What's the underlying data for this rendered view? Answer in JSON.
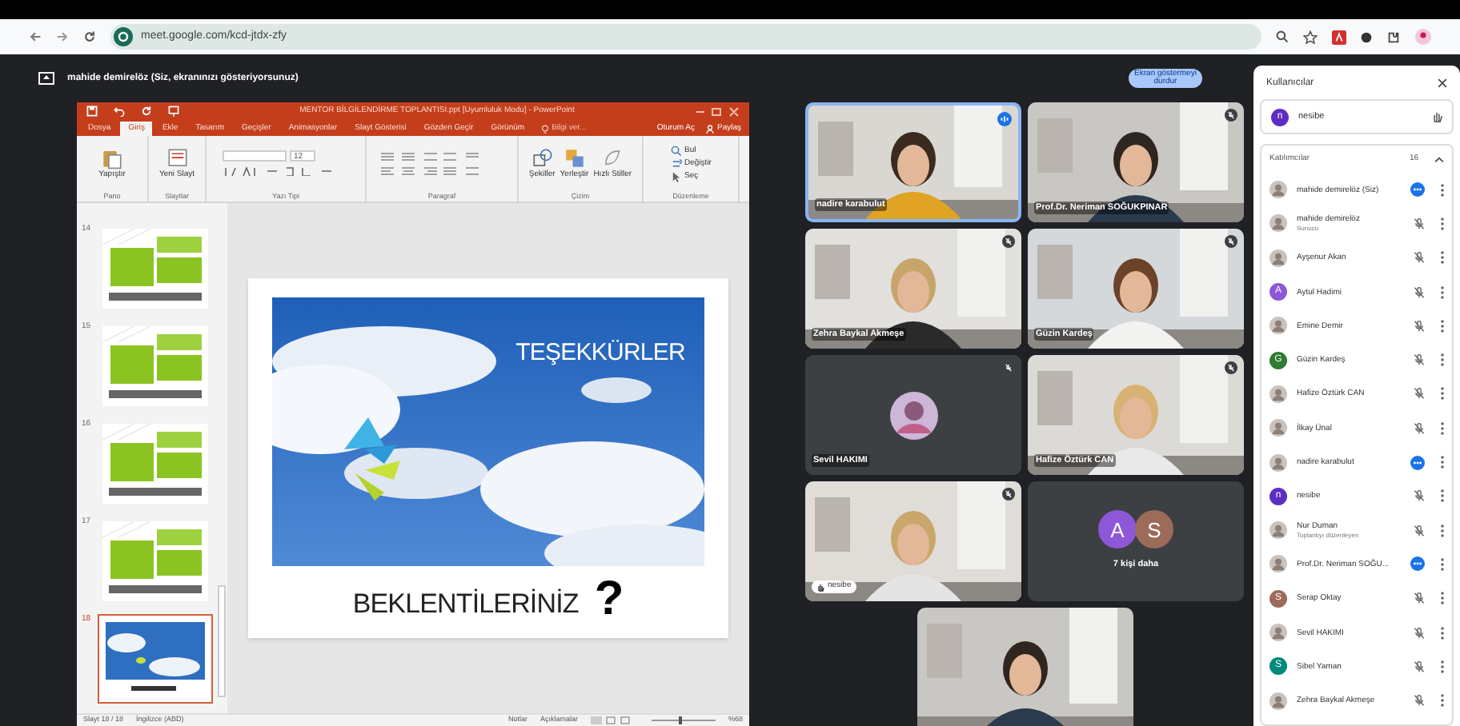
{
  "browser": {
    "url": "meet.google.com/kcd-jtdx-zfy"
  },
  "presenting_bar": {
    "text": "mahide demirelöz (Siz, ekranınızı gösteriyorsunuz)",
    "stop_button": "Ekran göstermeyi durdur"
  },
  "powerpoint": {
    "title": "MENTOR BİLGİLENDİRME TOPLANTISI.ppt [Uyumluluk Modu] - PowerPoint",
    "tabs": [
      {
        "label": "Dosya",
        "selected": false
      },
      {
        "label": "Giriş",
        "selected": true
      },
      {
        "label": "Ekle",
        "selected": false
      },
      {
        "label": "Tasarım",
        "selected": false
      },
      {
        "label": "Geçişler",
        "selected": false
      },
      {
        "label": "Animasyonlar",
        "selected": false
      },
      {
        "label": "Slayt Gösterisi",
        "selected": false
      },
      {
        "label": "Gözden Geçir",
        "selected": false
      },
      {
        "label": "Görünüm",
        "selected": false
      }
    ],
    "tell_me": "Bilgi ver...",
    "sign_in": "Oturum Aç",
    "share": "Paylaş",
    "ribbon": [
      {
        "kind": "buttons",
        "label": "Pano",
        "buttons": [
          {
            "kind": "paste",
            "label": "Yapıştır"
          }
        ]
      },
      {
        "kind": "buttons",
        "label": "Slaytlar",
        "buttons": [
          {
            "kind": "new_slide",
            "label": "Yeni Slayt"
          }
        ]
      },
      {
        "kind": "font",
        "label": "Yazı Tipi",
        "font_size": "12"
      },
      {
        "kind": "paragraph",
        "label": "Paragraf"
      },
      {
        "kind": "buttons",
        "label": "Çizim",
        "buttons": [
          {
            "kind": "shapes",
            "label": "Şekiller"
          },
          {
            "kind": "arrange",
            "label": "Yerleştir"
          },
          {
            "kind": "styles",
            "label": "Hızlı Stiller"
          }
        ]
      },
      {
        "kind": "editing",
        "label": "Düzenleme",
        "buttons": [
          {
            "kind": "find",
            "label": "Bul"
          },
          {
            "kind": "replace",
            "label": "Değiştir"
          },
          {
            "kind": "select",
            "label": "Seç"
          }
        ]
      }
    ],
    "thumbnails": [
      {
        "number": "14",
        "kind": "table",
        "selected": false
      },
      {
        "number": "15",
        "kind": "table",
        "selected": false
      },
      {
        "number": "16",
        "kind": "table",
        "selected": false
      },
      {
        "number": "17",
        "kind": "table",
        "selected": false
      },
      {
        "number": "18",
        "kind": "sky",
        "selected": true
      }
    ],
    "slide": {
      "heading": "TEŞEKKÜRLER",
      "caption": "BEKLENTİLERİNİZ",
      "mark": "?"
    },
    "status_bar": {
      "slide": "Slayt 18 / 18",
      "language": "İngilizce (ABD)",
      "notes": "Notlar",
      "comments": "Açıklamalar",
      "zoom": "%68",
      "zoom_slider": {
        "level": 0.45
      }
    }
  },
  "video_tiles": [
    {
      "kind": "video",
      "name": "nadire karabulut",
      "selected": true,
      "speaking": true
    },
    {
      "kind": "video",
      "name": "Prof.Dr. Neriman SOĞUKPINAR",
      "selected": false,
      "speaking": false
    },
    {
      "kind": "video",
      "name": "Zehra Baykal Akmeşe",
      "selected": false,
      "speaking": false
    },
    {
      "kind": "video",
      "name": "Güzin Kardeş",
      "selected": false,
      "speaking": false
    },
    {
      "kind": "avatar",
      "name": "Sevil HAKIMI",
      "selected": false,
      "speaking": false
    },
    {
      "kind": "video",
      "name": "Hafize Öztürk CAN",
      "selected": false,
      "speaking": false
    },
    {
      "kind": "hand",
      "name": "nesibe",
      "selected": false,
      "speaking": false
    },
    {
      "kind": "more",
      "label": "7 kişi daha",
      "avatars": [
        {
          "letter": "A",
          "color": "#8e57d8"
        },
        {
          "letter": "S",
          "color": "#9c6b5a"
        }
      ]
    },
    {
      "kind": "video",
      "selected": false,
      "speaking": false
    }
  ],
  "people_panel": {
    "title": "Kullanıcılar",
    "raised_hands": [
      {
        "name": "nesibe",
        "avatar": {
          "kind": "letter",
          "letter": "n",
          "color": "#5c2fc2"
        }
      }
    ],
    "section": {
      "title": "Katılımcılar",
      "count": "16",
      "expanded": true
    },
    "participants": [
      {
        "name": "mahide demirelöz (Siz)",
        "speaking": true
      },
      {
        "name": "mahide demirelöz",
        "subtitle": "Sunucu",
        "speaking": false
      },
      {
        "name": "Ayşenur Akan",
        "speaking": false
      },
      {
        "name": "Aytul Hadimi",
        "avatar": {
          "kind": "letter",
          "letter": "A",
          "color": "#8e57d8"
        },
        "speaking": false
      },
      {
        "name": "Emine Demir",
        "speaking": false
      },
      {
        "name": "Güzin Kardeş",
        "avatar": {
          "kind": "letter",
          "letter": "G",
          "color": "#2e7d32"
        },
        "speaking": false
      },
      {
        "name": "Hafize Öztürk CAN",
        "speaking": false
      },
      {
        "name": "İlkay Ünal",
        "speaking": false
      },
      {
        "name": "nadire karabulut",
        "speaking": true
      },
      {
        "name": "nesibe",
        "avatar": {
          "kind": "letter",
          "letter": "n",
          "color": "#5c2fc2"
        },
        "speaking": false
      },
      {
        "name": "Nur Duman",
        "subtitle": "Toplantıyı düzenleyen",
        "speaking": false
      },
      {
        "name": "Prof.Dr. Neriman SOĞU...",
        "speaking": true
      },
      {
        "name": "Serap Oktay",
        "avatar": {
          "kind": "letter",
          "letter": "S",
          "color": "#9c6b5a"
        },
        "speaking": false
      },
      {
        "name": "Sevil HAKIMI",
        "speaking": false
      },
      {
        "name": "Sibel Yaman",
        "avatar": {
          "kind": "letter",
          "letter": "S",
          "color": "#00897b"
        },
        "speaking": false
      },
      {
        "name": "Zehra Baykal Akmeşe",
        "speaking": false
      }
    ]
  }
}
